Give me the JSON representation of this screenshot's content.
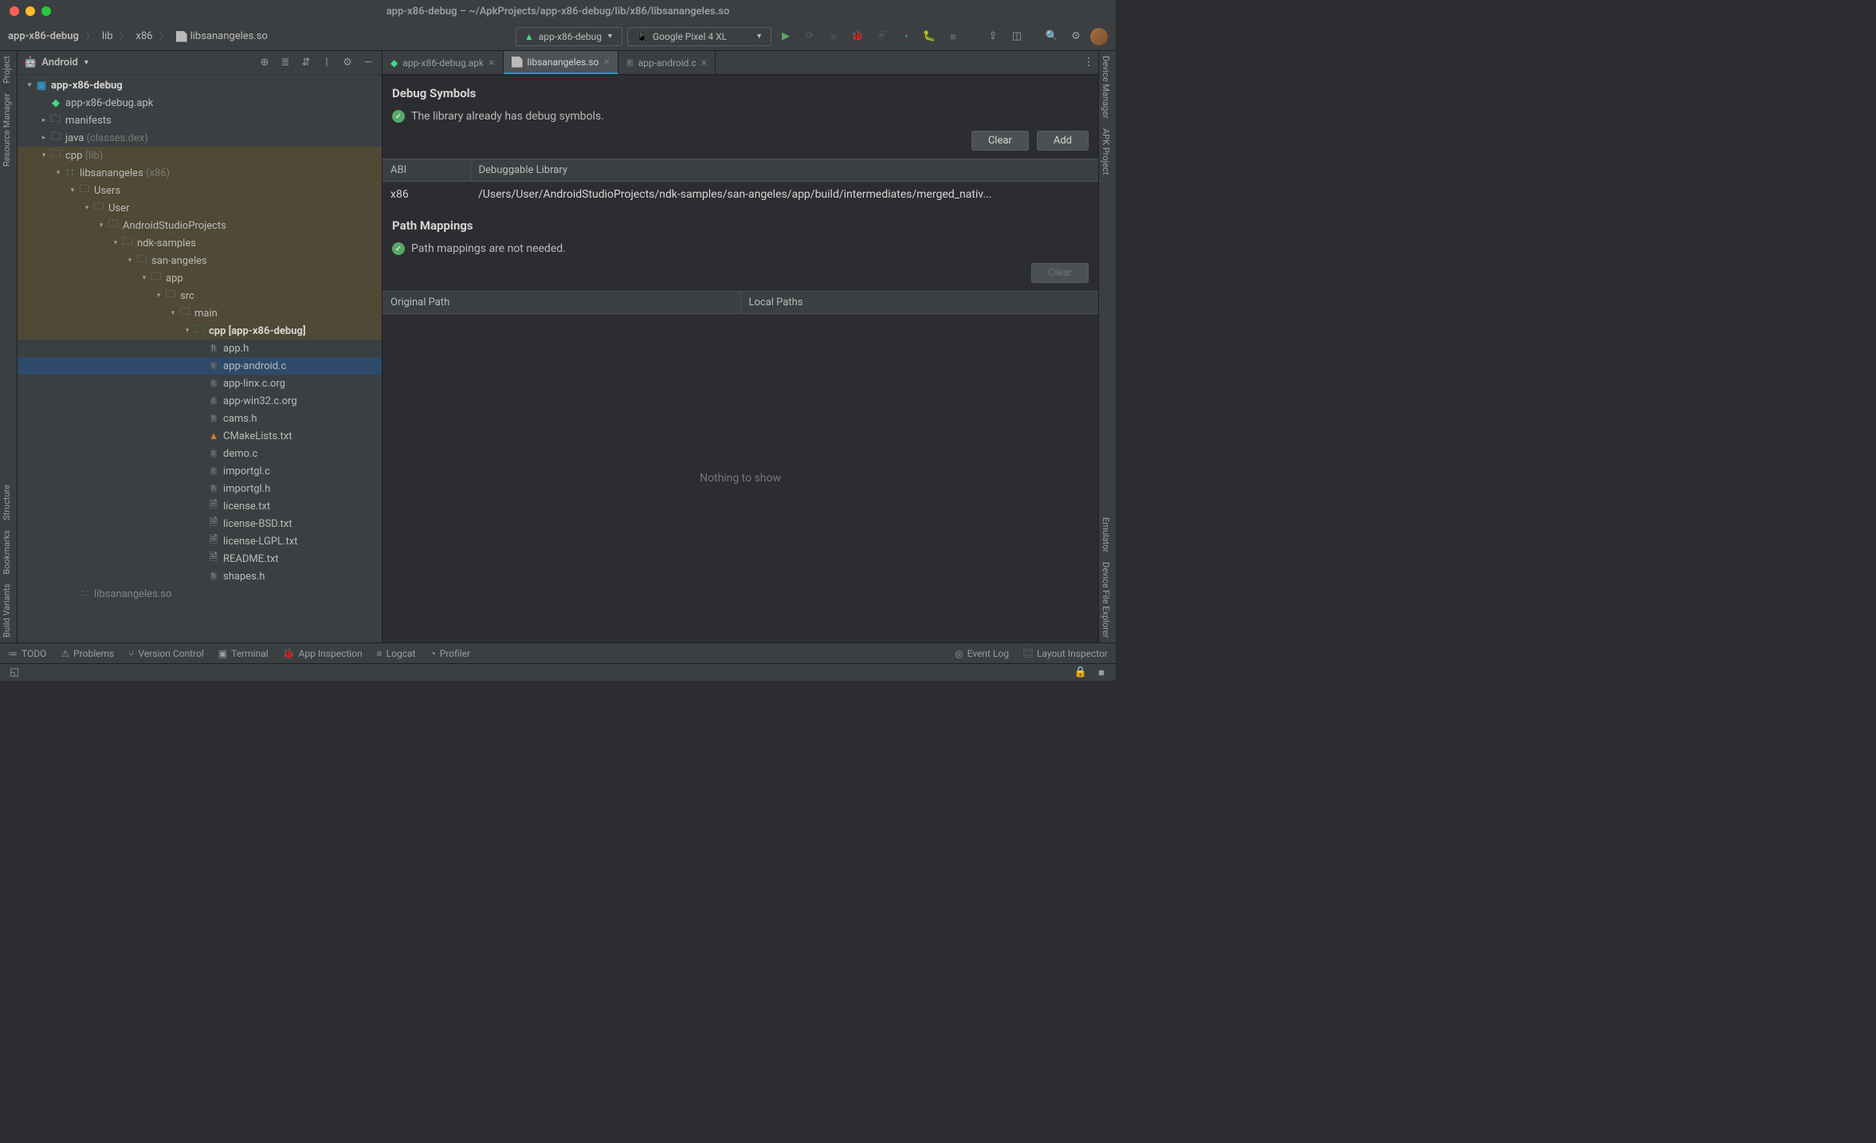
{
  "window": {
    "title": "app-x86-debug – ~/ApkProjects/app-x86-debug/lib/x86/libsanangeles.so"
  },
  "breadcrumb": [
    "app-x86-debug",
    "lib",
    "x86",
    "libsanangeles.so"
  ],
  "run_config": "app-x86-debug",
  "device_select": "Google Pixel 4 XL",
  "left_tools": {
    "top": [
      "Project",
      "Resource Manager"
    ],
    "bottom": [
      "Structure",
      "Bookmarks",
      "Build Variants"
    ]
  },
  "right_tools": {
    "top": [
      "Device Manager",
      "APK Project"
    ],
    "bottom": [
      "Emulator",
      "Device File Explorer"
    ]
  },
  "project_view_label": "Android",
  "tree": [
    {
      "indent": 0,
      "arrow": "down",
      "icon": "module",
      "label": "app-x86-debug",
      "root": true,
      "hl": false
    },
    {
      "indent": 1,
      "arrow": "none",
      "icon": "apk",
      "label": "app-x86-debug.apk",
      "hl": false
    },
    {
      "indent": 1,
      "arrow": "right",
      "icon": "folder",
      "label": "manifests",
      "hl": false
    },
    {
      "indent": 1,
      "arrow": "right",
      "icon": "folder",
      "label": "java",
      "dim": " (classes.dex)",
      "hl": false
    },
    {
      "indent": 1,
      "arrow": "down",
      "icon": "folder",
      "label": "cpp",
      "dim": " (lib)",
      "hl": true
    },
    {
      "indent": 2,
      "arrow": "down",
      "icon": "lib",
      "label": "libsanangeles",
      "dim": " (x86)",
      "hl": true
    },
    {
      "indent": 3,
      "arrow": "down",
      "icon": "folder",
      "label": "Users",
      "hl": true
    },
    {
      "indent": 4,
      "arrow": "down",
      "icon": "folder",
      "label": "User",
      "hl": true
    },
    {
      "indent": 5,
      "arrow": "down",
      "icon": "folder",
      "label": "AndroidStudioProjects",
      "hl": true
    },
    {
      "indent": 6,
      "arrow": "down",
      "icon": "folder",
      "label": "ndk-samples",
      "hl": true
    },
    {
      "indent": 7,
      "arrow": "down",
      "icon": "folder",
      "label": "san-angeles",
      "hl": true
    },
    {
      "indent": 8,
      "arrow": "down",
      "icon": "folder",
      "label": "app",
      "hl": true
    },
    {
      "indent": 9,
      "arrow": "down",
      "icon": "folder",
      "label": "src",
      "hl": true
    },
    {
      "indent": 10,
      "arrow": "down",
      "icon": "folder",
      "label": "main",
      "hl": true
    },
    {
      "indent": 11,
      "arrow": "down",
      "icon": "srcfolder",
      "label": "cpp [app-x86-debug]",
      "hl": true,
      "bold": true
    },
    {
      "indent": 12,
      "arrow": "none",
      "icon": "h",
      "label": "app.h",
      "hl": false
    },
    {
      "indent": 12,
      "arrow": "none",
      "icon": "c",
      "label": "app-android.c",
      "hl": false,
      "selected": true
    },
    {
      "indent": 12,
      "arrow": "none",
      "icon": "c",
      "label": "app-linx.c.org",
      "hl": false
    },
    {
      "indent": 12,
      "arrow": "none",
      "icon": "c",
      "label": "app-win32.c.org",
      "hl": false
    },
    {
      "indent": 12,
      "arrow": "none",
      "icon": "h",
      "label": "cams.h",
      "hl": false
    },
    {
      "indent": 12,
      "arrow": "none",
      "icon": "cmake",
      "label": "CMakeLists.txt",
      "hl": false
    },
    {
      "indent": 12,
      "arrow": "none",
      "icon": "c",
      "label": "demo.c",
      "hl": false
    },
    {
      "indent": 12,
      "arrow": "none",
      "icon": "c",
      "label": "importgl.c",
      "hl": false
    },
    {
      "indent": 12,
      "arrow": "none",
      "icon": "h",
      "label": "importgl.h",
      "hl": false
    },
    {
      "indent": 12,
      "arrow": "none",
      "icon": "txt",
      "label": "license.txt",
      "hl": false
    },
    {
      "indent": 12,
      "arrow": "none",
      "icon": "txt",
      "label": "license-BSD.txt",
      "hl": false
    },
    {
      "indent": 12,
      "arrow": "none",
      "icon": "txt",
      "label": "license-LGPL.txt",
      "hl": false
    },
    {
      "indent": 12,
      "arrow": "none",
      "icon": "txt",
      "label": "README.txt",
      "hl": false
    },
    {
      "indent": 12,
      "arrow": "none",
      "icon": "h",
      "label": "shapes.h",
      "hl": false
    },
    {
      "indent": 3,
      "arrow": "none",
      "icon": "lib",
      "label": "libsanangeles.so",
      "hl": false,
      "faded": true
    }
  ],
  "editor_tabs": [
    {
      "label": "app-x86-debug.apk",
      "icon": "apk",
      "active": false
    },
    {
      "label": "libsanangeles.so",
      "icon": "file",
      "active": true
    },
    {
      "label": "app-android.c",
      "icon": "c",
      "active": false
    }
  ],
  "debug_symbols": {
    "title": "Debug Symbols",
    "status": "The library already has debug symbols.",
    "clear_label": "Clear",
    "add_label": "Add",
    "columns": [
      "ABI",
      "Debuggable Library"
    ],
    "rows": [
      {
        "abi": "x86",
        "path": "/Users/User/AndroidStudioProjects/ndk-samples/san-angeles/app/build/intermediates/merged_nativ..."
      }
    ]
  },
  "path_mappings": {
    "title": "Path Mappings",
    "status": "Path mappings are not needed.",
    "clear_label": "Clear",
    "columns": [
      "Original Path",
      "Local Paths"
    ],
    "empty_text": "Nothing to show"
  },
  "bottom_bar": {
    "left": [
      "TODO",
      "Problems",
      "Version Control",
      "Terminal",
      "App Inspection",
      "Logcat",
      "Profiler"
    ],
    "right": [
      "Event Log",
      "Layout Inspector"
    ]
  }
}
